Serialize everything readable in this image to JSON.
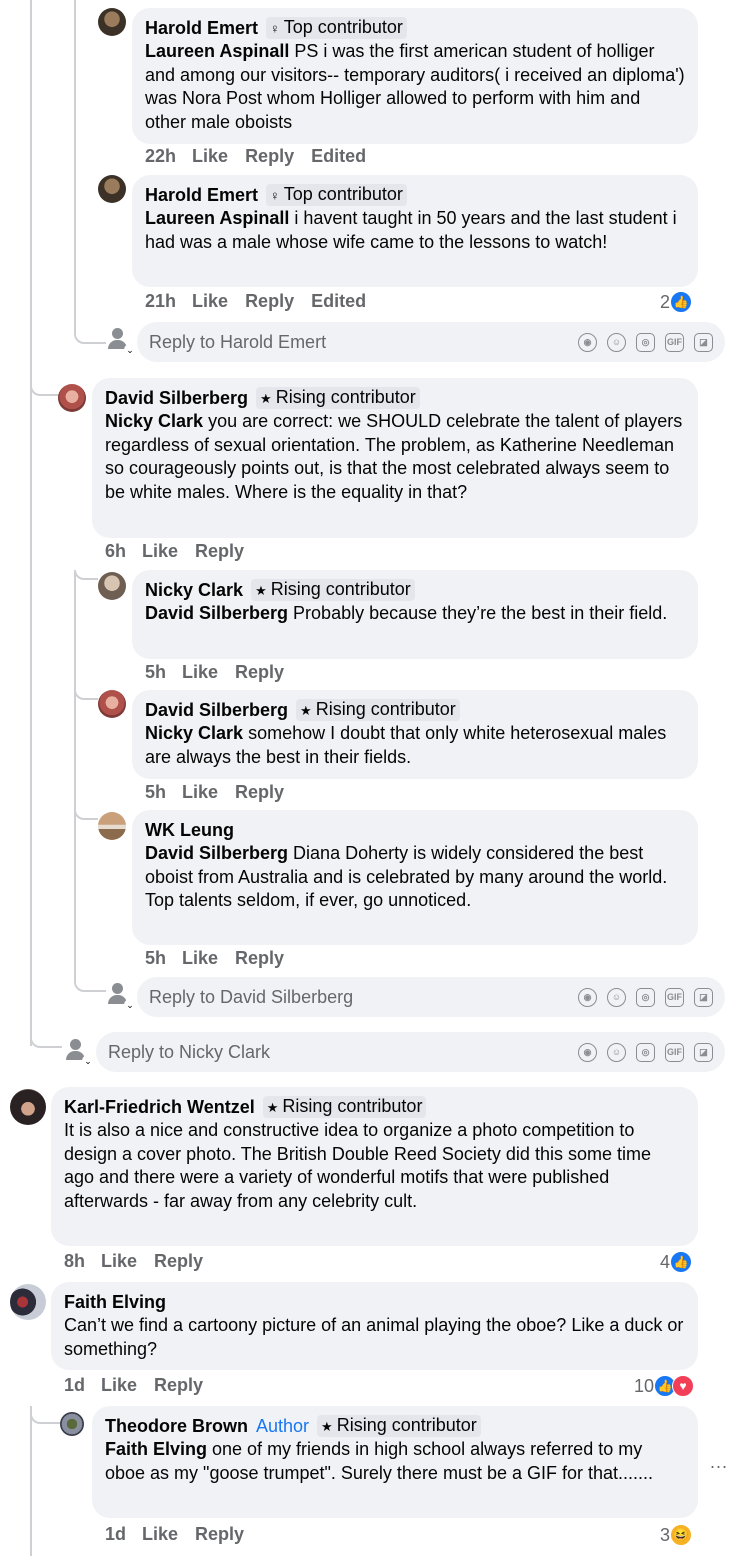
{
  "badges": {
    "top": "Top contributor",
    "rising": "Rising contributor",
    "author": "Author"
  },
  "c1": {
    "name": "Harold Emert",
    "mention": "Laureen Aspinall",
    "text": " PS i was the first american student of holliger and among our visitors-- temporary auditors( i received an diploma') was Nora Post whom Holliger allowed to perform with him and other male oboists",
    "time": "22h",
    "like": "Like",
    "reply": "Reply",
    "edited": "Edited"
  },
  "c2": {
    "name": "Harold Emert",
    "mention": "Laureen Aspinall",
    "text": " i havent taught in 50 years and the last student i had was a male whose wife came to the lessons to watch!",
    "time": "21h",
    "like": "Like",
    "reply": "Reply",
    "edited": "Edited",
    "reactions": "2"
  },
  "reply_harold": "Reply to Harold Emert",
  "c3": {
    "name": "David Silberberg",
    "mention": "Nicky Clark",
    "text": " you are correct: we SHOULD celebrate the talent of players regardless of sexual orientation. The problem, as Katherine Needleman so courageously points out, is that the most celebrated always seem to be white males. Where is the equality in that?",
    "time": "6h",
    "like": "Like",
    "reply": "Reply"
  },
  "c4": {
    "name": "Nicky Clark",
    "mention": "David Silberberg",
    "text": " Probably because they’re the best in their field.",
    "time": "5h",
    "like": "Like",
    "reply": "Reply"
  },
  "c5": {
    "name": "David Silberberg",
    "mention": "Nicky Clark",
    "text": " somehow I doubt that only white heterosexual males are always the best in their fields.",
    "time": "5h",
    "like": "Like",
    "reply": "Reply"
  },
  "c6": {
    "name": "WK Leung",
    "mention": "David Silberberg",
    "text": " Diana Doherty is widely considered the best oboist from Australia and is celebrated by many around the world. Top talents seldom, if ever, go unnoticed.",
    "time": "5h",
    "like": "Like",
    "reply": "Reply"
  },
  "reply_david": "Reply to David Silberberg",
  "reply_nicky": "Reply to Nicky Clark",
  "c7": {
    "name": "Karl-Friedrich Wentzel",
    "text": "It is also a nice and constructive idea to organize a photo competition to design a cover photo. The British Double Reed Society did this some time ago and there were a variety of wonderful motifs that were published afterwards - far away from any celebrity cult.",
    "time": "8h",
    "like": "Like",
    "reply": "Reply",
    "reactions": "4"
  },
  "c8": {
    "name": "Faith Elving",
    "text": "Can’t we find a cartoony picture of an animal playing the oboe? Like a duck or something?",
    "time": "1d",
    "like": "Like",
    "reply": "Reply",
    "reactions": "10"
  },
  "c9": {
    "name": "Theodore Brown",
    "mention": "Faith Elving",
    "text": " one of my friends in high school always referred to my oboe as my \"goose trumpet\". Surely there must be a GIF for that.......",
    "time": "1d",
    "like": "Like",
    "reply": "Reply",
    "reactions": "3"
  },
  "more": "...",
  "tool_icons": [
    "avatar-sticker-icon",
    "emoji-icon",
    "camera-icon",
    "gif-icon",
    "sticker-icon"
  ],
  "colors": {
    "like_blue": "#1877f2",
    "bubble_bg": "#f0f2f5",
    "meta_grey": "#65676b"
  }
}
